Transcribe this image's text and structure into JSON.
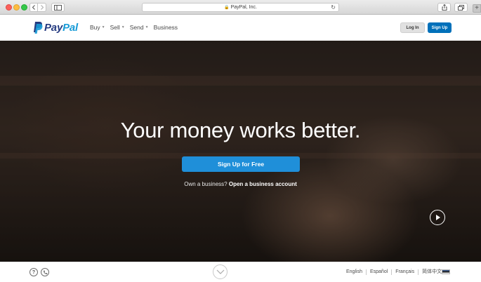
{
  "browser": {
    "address": "PayPal, Inc.",
    "secure": true,
    "icons": [
      "back-icon",
      "forward-icon",
      "sidebar-icon",
      "lock-icon",
      "reload-icon",
      "share-icon",
      "tabs-icon",
      "new-tab-icon"
    ],
    "new_tab_glyph": "+"
  },
  "header": {
    "logo": {
      "pay": "Pay",
      "pal": "Pal"
    },
    "nav": [
      {
        "label": "Buy",
        "has_menu": true
      },
      {
        "label": "Sell",
        "has_menu": true
      },
      {
        "label": "Send",
        "has_menu": true
      },
      {
        "label": "Business",
        "has_menu": false
      }
    ],
    "login_label": "Log In",
    "signup_label": "Sign Up"
  },
  "hero": {
    "headline": "Your money works better.",
    "cta_label": "Sign Up for Free",
    "business_prompt": "Own a business?",
    "business_link": "Open a business account"
  },
  "footer": {
    "help_glyph": "?",
    "languages": [
      "English",
      "Español",
      "Français",
      "简体中文"
    ]
  },
  "colors": {
    "primary": "#0070ba",
    "cta": "#1f8fd9",
    "logo_dark": "#253b80",
    "logo_light": "#179bd7"
  }
}
